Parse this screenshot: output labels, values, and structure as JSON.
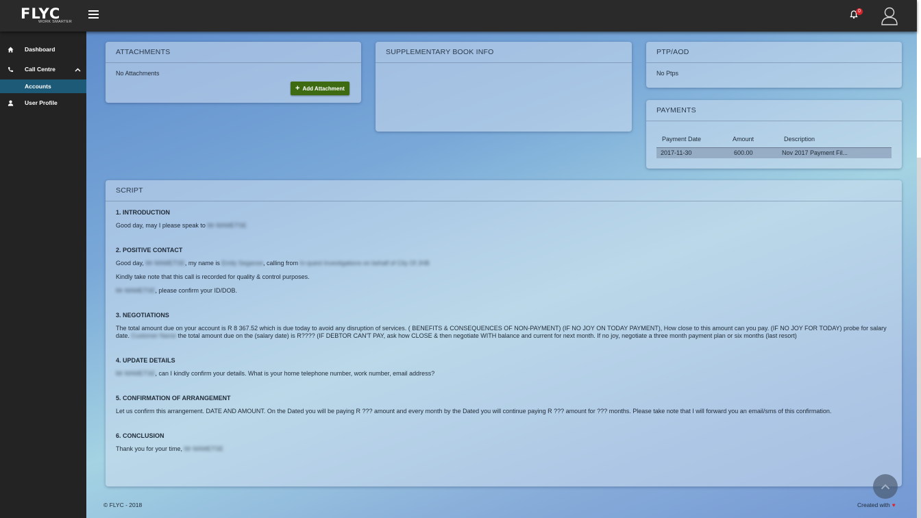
{
  "header": {
    "logo_text": "FLYC",
    "logo_tagline": "WORK SMARTER",
    "notification_count": "0"
  },
  "sidebar": {
    "items": [
      {
        "label": "Dashboard",
        "icon": "home-icon"
      },
      {
        "label": "Call Centre",
        "icon": "phone-icon",
        "expanded": true,
        "children": [
          {
            "label": "Accounts",
            "active": true
          }
        ]
      },
      {
        "label": "User Profile",
        "icon": "user-icon"
      }
    ]
  },
  "attachments": {
    "title": "ATTACHMENTS",
    "empty_text": "No Attachments",
    "add_label": "Add Attachment"
  },
  "supplementary": {
    "title": "SUPPLEMENTARY BOOK INFO"
  },
  "ptp": {
    "title": "PTP/AOD",
    "empty_text": "No Ptps"
  },
  "payments": {
    "title": "PAYMENTS",
    "columns": [
      "Payment Date",
      "Amount",
      "Description"
    ],
    "rows": [
      [
        "2017-11-30",
        "600.00",
        "Nov 2017 Payment Fil..."
      ]
    ]
  },
  "script": {
    "title": "SCRIPT",
    "sections": [
      {
        "heading": "1. INTRODUCTION"
      },
      {
        "heading": "2. POSITIVE CONTACT"
      },
      {
        "heading": "3. NEGOTIATIONS"
      },
      {
        "heading": "4. UPDATE DETAILS"
      },
      {
        "heading": "5. CONFIRMATION OF ARRANGEMENT"
      },
      {
        "heading": "6. CONCLUSION"
      }
    ],
    "intro_text": "Good day, may I please speak to",
    "redacted_name": "Mr MAMETSE",
    "redacted_agent": "Emily Seganoe",
    "redacted_company": "In-quest Investigations on behalf of City Of JHB",
    "redacted_customer": "Customer Name",
    "positive_1a": "Good day,",
    "positive_1b": ", my name is",
    "positive_1c": ", calling from",
    "positive_2": "Kindly take note that this call is recorded for quality & control purposes.",
    "positive_3": ", please confirm your ID/DOB.",
    "negotiation_a": "The total amount due on your account is R 8 367.52 which is due today to avoid any disruption of services. ( BENEFITS & CONSEQUENCES OF NON-PAYMENT) (IF NO JOY ON TODAY PAYMENT), How close to this amount can you pay. (IF NO JOY FOR TODAY) probe for salary date.",
    "negotiation_b": "the total amount due on the (salary date) is R???? (IF DEBTOR CAN'T PAY, ask how CLOSE & then negotiate WITH balance and current for next month. If no joy, negotiate a three month payment plan or six months (last resort)",
    "update_text": ", can I kindly confirm your details. What is your home telephone number, work number, email address?",
    "confirmation_text": "Let us confirm this arrangement. DATE AND AMOUNT. On the Dated you will be paying R ??? amount and every month by the Dated you will continue paying R ??? amount for ??? months. Please take note that I will forward you an email/sms of this confirmation.",
    "conclusion_text": "Thank you for your time,"
  },
  "footer": {
    "copyright": "© FLYC - 2018",
    "created_with": "Created with"
  }
}
